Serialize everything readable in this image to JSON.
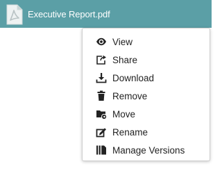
{
  "file": {
    "name": "Executive Report.pdf",
    "icon": "pdf-file-icon"
  },
  "colors": {
    "bar": "#5b9fa6",
    "menu_text": "#222222"
  },
  "menu": {
    "items": [
      {
        "label": "View",
        "icon": "eye-icon"
      },
      {
        "label": "Share",
        "icon": "share-icon"
      },
      {
        "label": "Download",
        "icon": "download-icon"
      },
      {
        "label": "Remove",
        "icon": "trash-icon"
      },
      {
        "label": "Move",
        "icon": "folder-move-icon"
      },
      {
        "label": "Rename",
        "icon": "rename-icon"
      },
      {
        "label": "Manage Versions",
        "icon": "versions-icon"
      }
    ]
  }
}
